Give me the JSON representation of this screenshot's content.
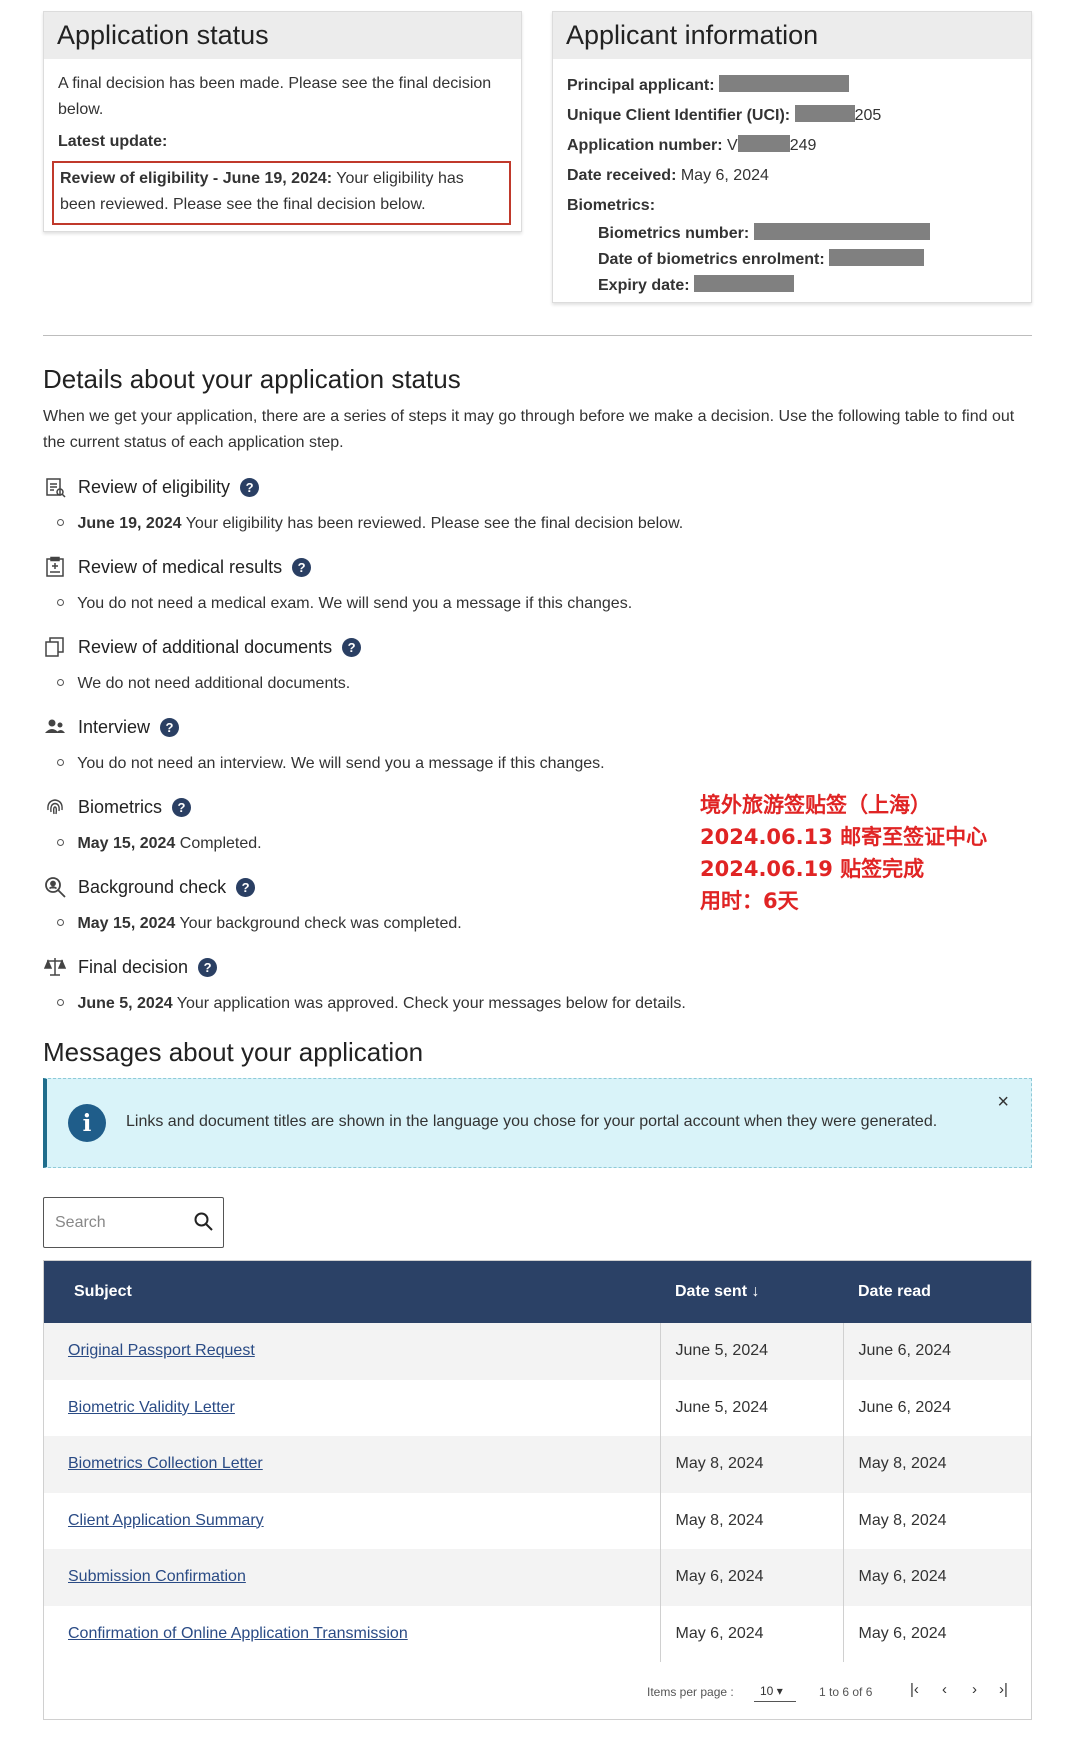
{
  "status_card": {
    "title": "Application status",
    "message": "A final decision has been made. Please see the final decision below.",
    "latest_label": "Latest update:",
    "latest_bold": "Review of eligibility - June 19, 2024:",
    "latest_text": "Your eligibility has been reviewed. Please see the final decision below."
  },
  "info_card": {
    "title": "Applicant information",
    "principal_label": "Principal applicant:",
    "uci_label": "Unique Client Identifier (UCI):",
    "uci_suffix": "205",
    "app_number_label": "Application number:",
    "app_number_prefix": "V",
    "app_number_suffix": "249",
    "date_received_label": "Date received:",
    "date_received": "May 6, 2024",
    "biometrics_label": "Biometrics:",
    "bio_number_label": "Biometrics number:",
    "bio_date_label": "Date of biometrics enrolment:",
    "expiry_label": "Expiry date:"
  },
  "details": {
    "heading": "Details about your application status",
    "intro": "When we get your application, there are a series of steps it may go through before we make a decision. Use the following table to find out the current status of each application step.",
    "steps": [
      {
        "name": "Review of eligibility",
        "icon": "clipboard-check-icon",
        "date": "June 19, 2024",
        "text": "Your eligibility has been reviewed. Please see the final decision below."
      },
      {
        "name": "Review of medical results",
        "icon": "medical-clipboard-icon",
        "date": "",
        "text": "You do not need a medical exam. We will send you a message if this changes."
      },
      {
        "name": "Review of additional documents",
        "icon": "documents-icon",
        "date": "",
        "text": "We do not need additional documents."
      },
      {
        "name": "Interview",
        "icon": "people-icon",
        "date": "",
        "text": "You do not need an interview. We will send you a message if this changes."
      },
      {
        "name": "Biometrics",
        "icon": "fingerprint-icon",
        "date": "May 15, 2024",
        "text": "Completed."
      },
      {
        "name": "Background check",
        "icon": "magnifier-person-icon",
        "date": "May 15, 2024",
        "text": "Your background check was completed."
      },
      {
        "name": "Final decision",
        "icon": "scales-icon",
        "date": "June 5, 2024",
        "text": "Your application was approved. Check your messages below for details."
      }
    ],
    "help_glyph": "?"
  },
  "note": {
    "line1": "境外旅游签贴签（上海）",
    "line2": "2024.06.13 邮寄至签证中心",
    "line3": "2024.06.19 贴签完成",
    "line4": "用时：6天",
    "color": "#e02424"
  },
  "messages": {
    "heading": "Messages about your application",
    "alert_text": "Links and document titles are shown in the language you chose for your portal account when they were generated.",
    "alert_close": "×",
    "search_placeholder": "Search",
    "columns": {
      "subject": "Subject",
      "date_sent": "Date sent ↓",
      "date_read": "Date read"
    },
    "rows": [
      {
        "subject": "Original Passport Request",
        "sent": "June 5, 2024",
        "read": "June 6, 2024"
      },
      {
        "subject": "Biometric Validity Letter",
        "sent": "June 5, 2024",
        "read": "June 6, 2024"
      },
      {
        "subject": "Biometrics Collection Letter",
        "sent": "May 8, 2024",
        "read": "May 8, 2024"
      },
      {
        "subject": "Client Application Summary",
        "sent": "May 8, 2024",
        "read": "May 8, 2024"
      },
      {
        "subject": "Submission Confirmation",
        "sent": "May 6, 2024",
        "read": "May 6, 2024"
      },
      {
        "subject": "Confirmation of Online Application Transmission",
        "sent": "May 6, 2024",
        "read": "May 6, 2024"
      }
    ],
    "pager": {
      "items_label": "Items per page :",
      "items_value": "10",
      "range": "1 to 6 of 6",
      "first": "|‹",
      "prev": "‹",
      "next": "›",
      "last": "›|"
    }
  },
  "colors": {
    "header_bg": "#2b4166",
    "link": "#2a4b85",
    "alert_bg": "#d9f3f9",
    "help_bg": "#2a3f63"
  }
}
